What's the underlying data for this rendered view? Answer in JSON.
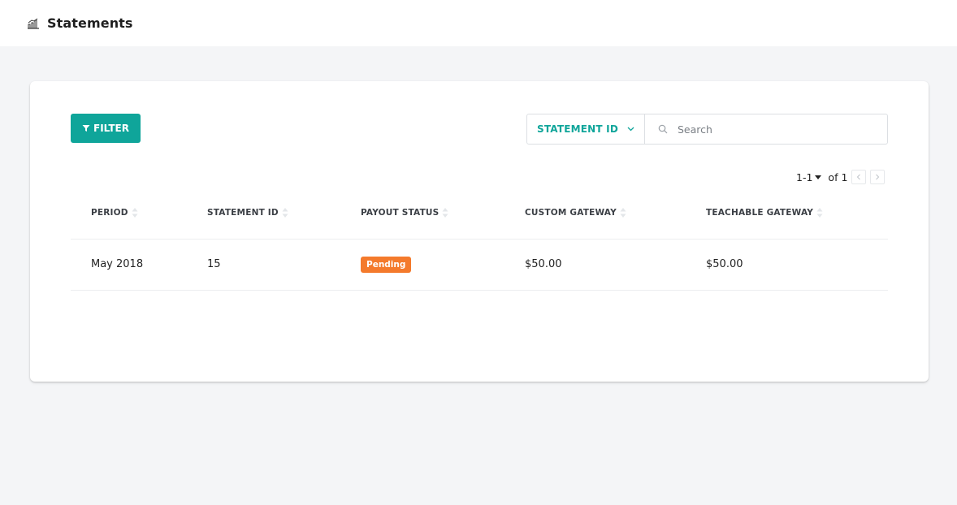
{
  "header": {
    "title": "Statements",
    "icon": "bar-chart-icon"
  },
  "toolbar": {
    "filter_label": "FILTER",
    "filter_icon": "filter-icon",
    "search_by_label": "STATEMENT ID",
    "search_placeholder": "Search"
  },
  "pagination": {
    "range": "1-1",
    "of_label": "of 1"
  },
  "table": {
    "columns": [
      "PERIOD",
      "STATEMENT ID",
      "PAYOUT STATUS",
      "CUSTOM GATEWAY",
      "TEACHABLE GATEWAY"
    ],
    "rows": [
      {
        "period": "May 2018",
        "statement_id": "15",
        "payout_status": "Pending",
        "custom_gateway": "$50.00",
        "teachable_gateway": "$50.00"
      }
    ]
  },
  "colors": {
    "accent": "#0fa59a",
    "pending_badge": "#f47a2c"
  }
}
